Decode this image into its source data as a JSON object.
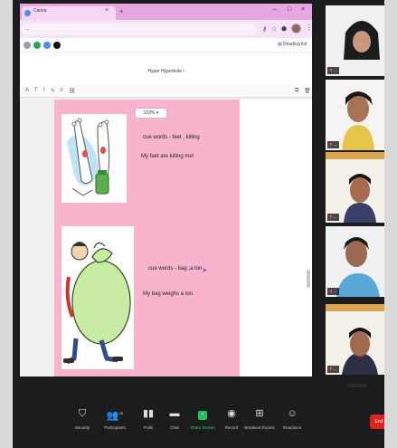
{
  "browser": {
    "tab_label": "Canva",
    "url": "...",
    "reading_list": "Reading list",
    "doc_title": "Hyper Hyperbole !",
    "zoom_level": "103%"
  },
  "slide": {
    "cue1": "cue words - feet , killing",
    "sentence1": "My feet are killing me!",
    "cue2": "cue words - bag ,a ton",
    "sentence2": "My bag weighs a ton."
  },
  "participants": [
    {
      "name": "...",
      "muted": true
    },
    {
      "name": "...",
      "muted": true
    },
    {
      "name": "...",
      "muted": true
    },
    {
      "name": "...",
      "muted": true
    },
    {
      "name": "...",
      "muted": true
    }
  ],
  "controls": {
    "security": "Security",
    "participants": "Participants",
    "participants_count": "25",
    "polls": "Polls",
    "chat": "Chat",
    "share_screen": "Share Screen",
    "record": "Record",
    "breakout_rooms": "Breakout Rooms",
    "reactions": "Reactions",
    "end": "End"
  },
  "colors": {
    "slide_background": "#f8b4cd",
    "browser_theme": "#e6a6e2",
    "share_green": "#1fbf5a",
    "end_red": "#e0231c"
  }
}
